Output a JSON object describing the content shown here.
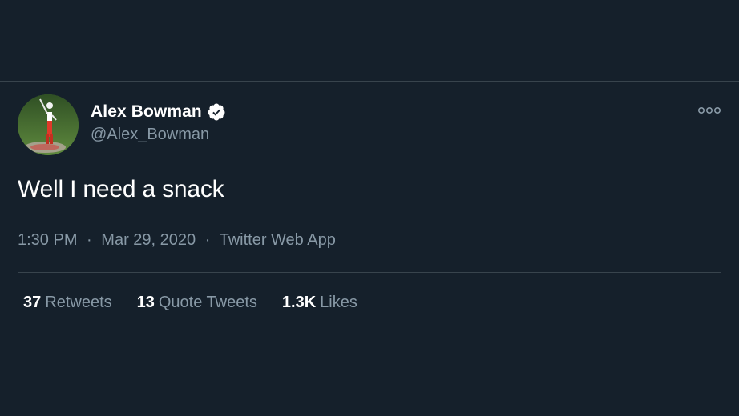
{
  "tweet": {
    "author": {
      "display_name": "Alex Bowman",
      "handle": "@Alex_Bowman",
      "verified": true,
      "verified_icon": "verified-badge-icon",
      "avatar_icon": "avatar-photo"
    },
    "text": "Well I need a snack",
    "time": "1:30 PM",
    "date": "Mar 29, 2020",
    "separator": "·",
    "source": "Twitter Web App",
    "more_icon": "more-options-icon",
    "stats": {
      "retweets": {
        "count": "37",
        "label": "Retweets"
      },
      "quote_tweets": {
        "count": "13",
        "label": "Quote Tweets"
      },
      "likes": {
        "count": "1.3K",
        "label": "Likes"
      }
    }
  },
  "colors": {
    "background": "#15202b",
    "divider": "#38444d",
    "primary_text": "#ffffff",
    "secondary_text": "#8899a6"
  }
}
